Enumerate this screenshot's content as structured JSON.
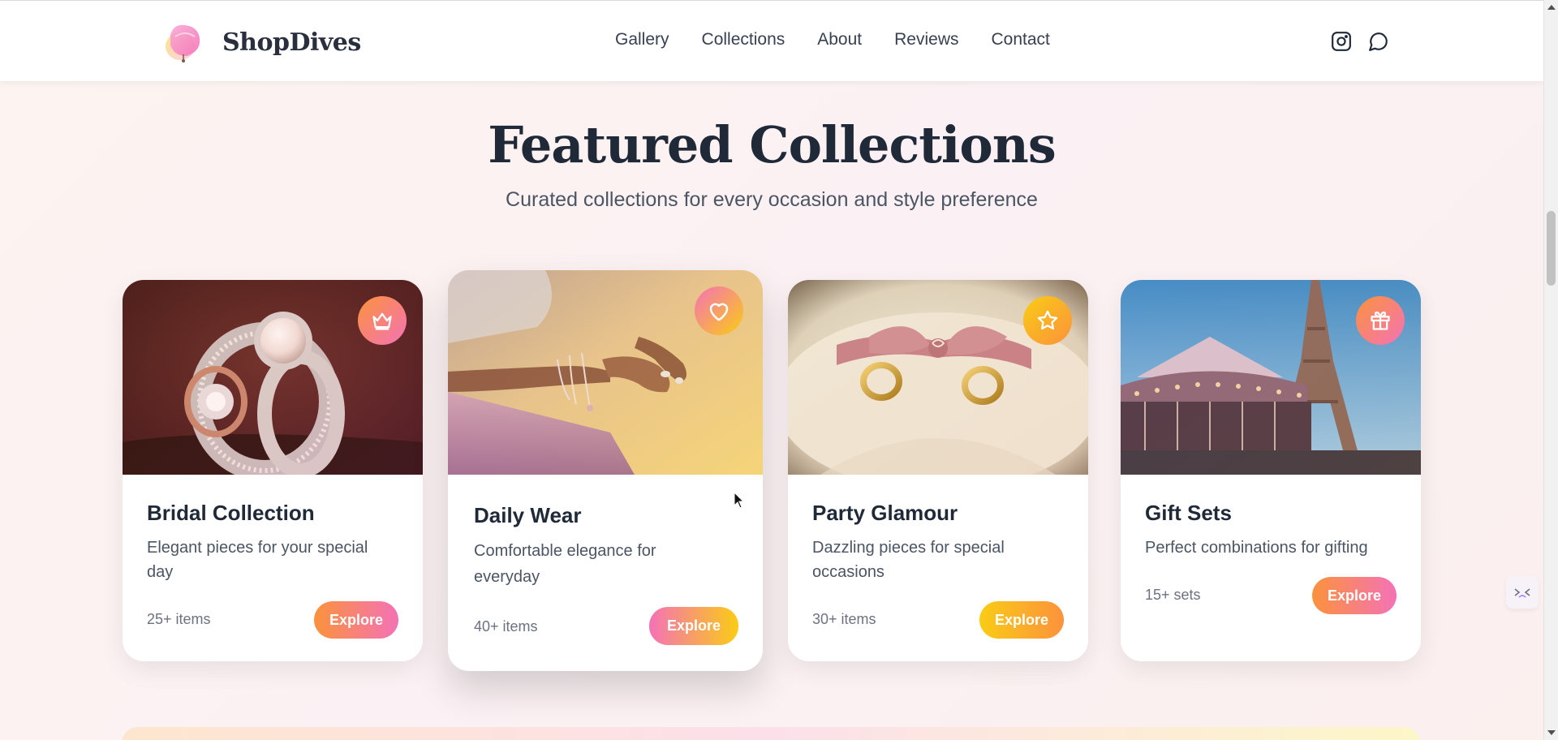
{
  "header": {
    "brand": "ShopDives",
    "nav": [
      "Gallery",
      "Collections",
      "About",
      "Reviews",
      "Contact"
    ],
    "icons": [
      "instagram-icon",
      "message-circle-icon"
    ]
  },
  "section": {
    "title": "Featured Collections",
    "subtitle": "Curated collections for every occasion and style preference"
  },
  "cards": [
    {
      "title": "Bridal Collection",
      "desc1": "Elegant pieces for your special",
      "desc2": "day",
      "count": "25+ items",
      "button": "Explore",
      "badge_icon": "crown-icon",
      "accent": "#f97b6b"
    },
    {
      "title": "Daily Wear",
      "desc1": "Comfortable elegance for",
      "desc2": "everyday",
      "count": "40+ items",
      "button": "Explore",
      "badge_icon": "heart-icon",
      "accent": "#f472b6"
    },
    {
      "title": "Party Glamour",
      "desc1": "Dazzling pieces for special",
      "desc2": "occasions",
      "count": "30+ items",
      "button": "Explore",
      "badge_icon": "star-icon",
      "accent": "#fbbf24"
    },
    {
      "title": "Gift Sets",
      "desc1": "Perfect combinations for gifting",
      "desc2": "",
      "count": "15+ sets",
      "button": "Explore",
      "badge_icon": "gift-icon",
      "accent": "#f472b6"
    }
  ],
  "colors": {
    "orange_pink": [
      "#fb923c",
      "#f472b6"
    ],
    "pink_yellow": [
      "#f472b6",
      "#facc15"
    ],
    "yellow_orange": [
      "#facc15",
      "#fb923c"
    ]
  }
}
